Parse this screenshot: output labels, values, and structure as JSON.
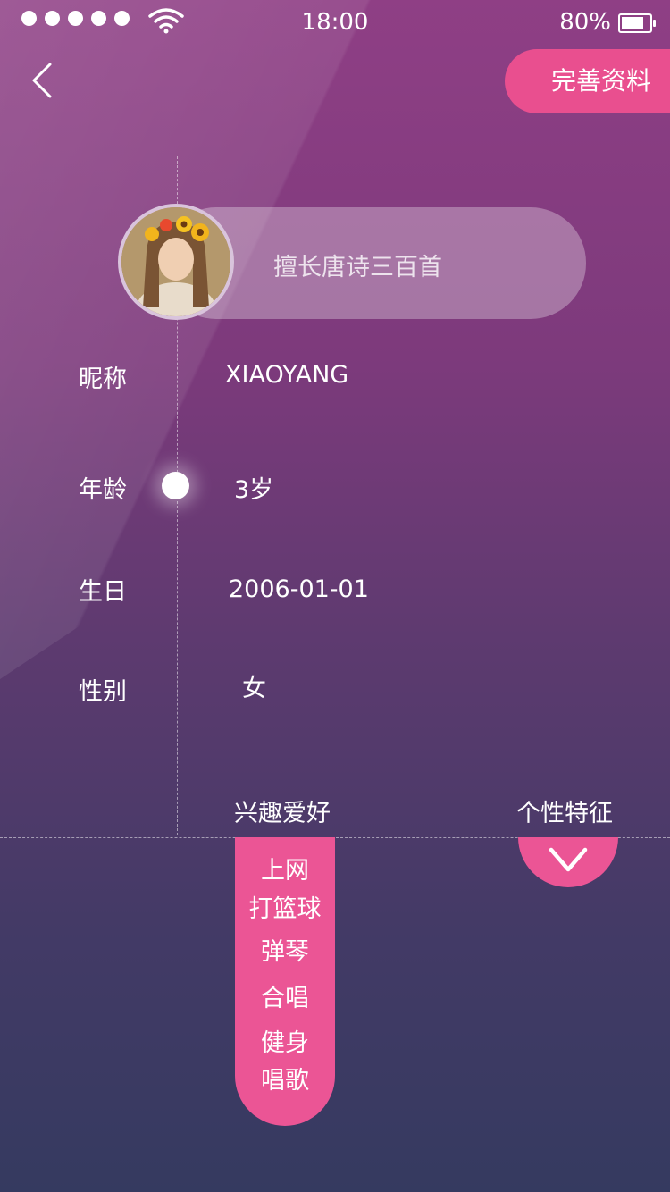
{
  "status_bar": {
    "time": "18:00",
    "battery_percent": "80%",
    "signal_dots": 5,
    "battery_level": 0.8
  },
  "header": {
    "back_icon": "chevron-left-icon",
    "complete_button_label": "完善资料"
  },
  "profile": {
    "avatar": "avatar-photo",
    "bio": "擅长唐诗三百首",
    "fields": [
      {
        "label": "昵称",
        "value": "XIAOYANG"
      },
      {
        "label": "年龄",
        "value": "3岁"
      },
      {
        "label": "生日",
        "value": "2006-01-01"
      },
      {
        "label": "性别",
        "value": "女"
      }
    ]
  },
  "tabs": {
    "hobbies_label": "兴趣爱好",
    "traits_label": "个性特征",
    "hobbies": [
      "上网",
      "打篮球",
      "弹琴",
      "合唱",
      "健身",
      "唱歌"
    ],
    "traits_toggle_icon": "chevron-down-icon"
  },
  "colors": {
    "accent": "#eb5595",
    "bg_top": "#8f3f85",
    "bg_bottom": "#353a60"
  }
}
